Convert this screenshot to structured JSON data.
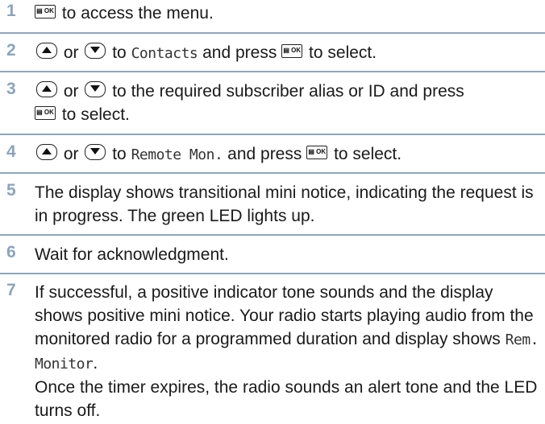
{
  "keys": {
    "ok": "▤ OK"
  },
  "steps": [
    {
      "num": "1",
      "text": "to access the menu."
    },
    {
      "num": "2",
      "or": "or",
      "to": "to",
      "menu_item": "Contacts",
      "press": "and press",
      "end": "to select."
    },
    {
      "num": "3",
      "or": "or",
      "text_a": "to the required subscriber alias or ID and press",
      "end": "to select."
    },
    {
      "num": "4",
      "or": "or",
      "to": "to",
      "menu_item": "Remote Mon.",
      "press": "and press",
      "end": "to select."
    },
    {
      "num": "5",
      "text": "The display shows transitional mini notice, indicating the request is in progress. The green LED lights up."
    },
    {
      "num": "6",
      "text": "Wait for acknowledgment."
    },
    {
      "num": "7",
      "text_a": "If successful, a positive indicator tone sounds and the display shows positive mini notice. Your radio starts playing audio from the monitored radio for a programmed duration and display shows",
      "display_text": "Rem. Monitor",
      "text_b": "Once the timer expires, the radio sounds an alert tone and the LED turns off."
    }
  ]
}
